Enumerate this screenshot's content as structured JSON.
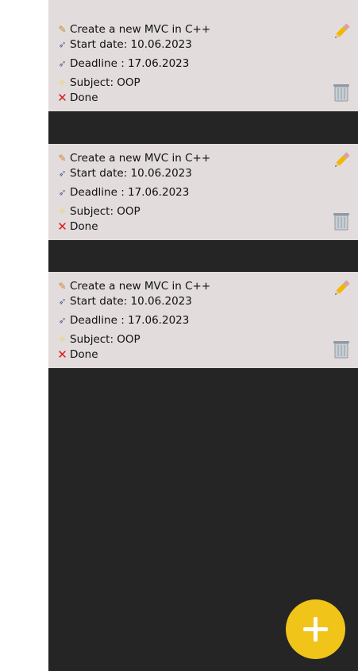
{
  "tasks": [
    {
      "title": "Create a new MVC in C++",
      "start": "Start date: 10.06.2023",
      "deadline": "Deadline : 17.06.2023",
      "subject": "Subject: OOP",
      "status": "Done"
    },
    {
      "title": "Create a new MVC in C++",
      "start": "Start date: 10.06.2023",
      "deadline": "Deadline : 17.06.2023",
      "subject": "Subject: OOP",
      "status": "Done"
    },
    {
      "title": "Create a new MVC in C++",
      "start": "Start date: 10.06.2023",
      "deadline": "Deadline : 17.06.2023",
      "subject": "Subject: OOP",
      "status": "Done"
    }
  ],
  "colors": {
    "app_background": "#252525",
    "card_background": "#e2dcdc",
    "fab_background": "#f0c419",
    "done_icon": "#e11919"
  },
  "icons": {
    "title": "memo-icon",
    "start": "rocket-icon",
    "deadline": "rocket-icon",
    "subject": "sparkles-icon",
    "status": "cross-mark-icon",
    "edit": "pencil-icon",
    "delete": "trash-can-icon",
    "add": "plus-icon"
  }
}
